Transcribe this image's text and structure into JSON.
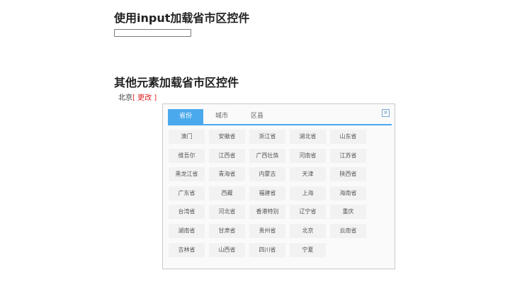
{
  "section1": {
    "title": "使用input加载省市区控件",
    "input_value": ""
  },
  "section2": {
    "title": "其他元素加载省市区控件",
    "selected_city": "北京",
    "change_label": "[ 更改 ]"
  },
  "picker": {
    "close_symbol": "×",
    "tabs": [
      "省份",
      "城市",
      "区县"
    ],
    "active_tab": "省份",
    "provinces": [
      "澳门",
      "安徽省",
      "浙江省",
      "湖北省",
      "山东省",
      "维吾尔",
      "江西省",
      "广西壮族",
      "河南省",
      "江苏省",
      "黑龙江省",
      "青海省",
      "内蒙古",
      "天津",
      "陕西省",
      "广东省",
      "西藏",
      "福建省",
      "上海",
      "海南省",
      "台湾省",
      "河北省",
      "香港特别",
      "辽宁省",
      "重庆",
      "湖南省",
      "甘肃省",
      "贵州省",
      "北京",
      "云南省",
      "吉林省",
      "山西省",
      "四川省",
      "宁夏"
    ],
    "colors": {
      "accent": "#4aa9ec",
      "change_link": "#e02020"
    }
  }
}
